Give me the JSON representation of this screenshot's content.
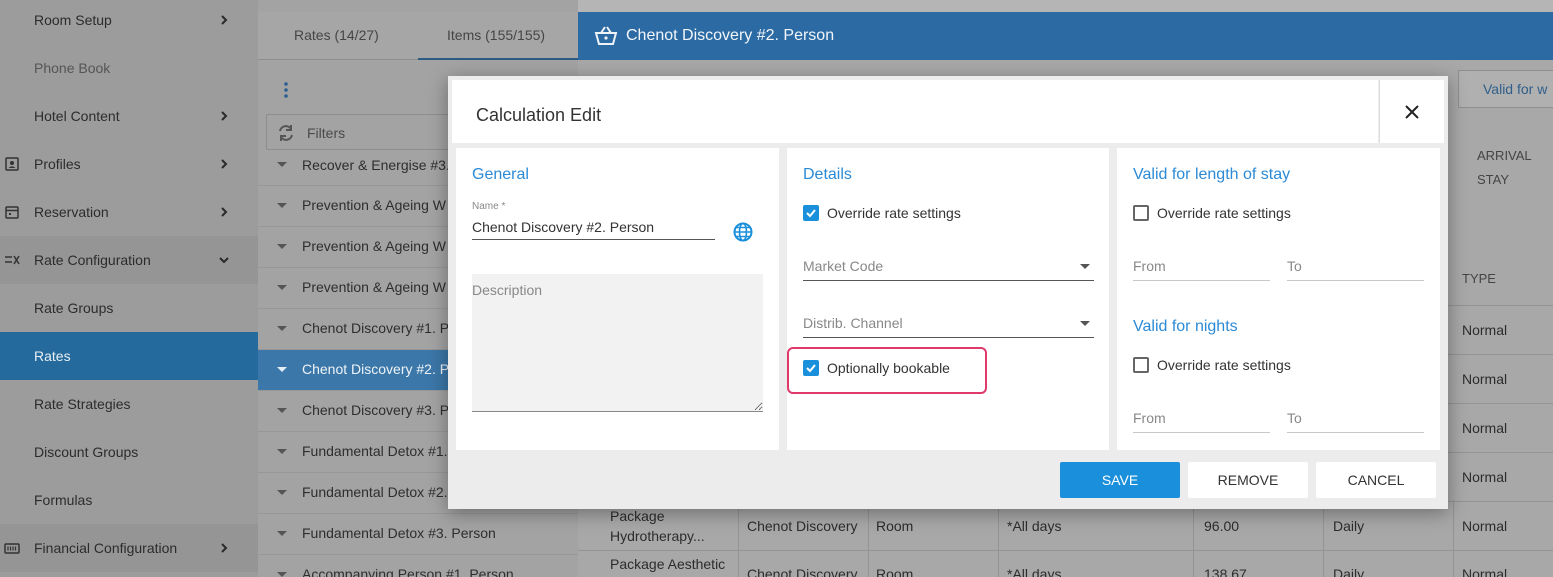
{
  "sidebar": {
    "items": [
      {
        "label": "Room Setup",
        "icon": "none",
        "chevron": "right"
      },
      {
        "label": "Phone Book",
        "icon": "none",
        "chevron": "none"
      },
      {
        "label": "Hotel Content",
        "icon": "none",
        "chevron": "right"
      },
      {
        "label": "Profiles",
        "icon": "profile-icon",
        "chevron": "right"
      },
      {
        "label": "Reservation",
        "icon": "calendar-icon",
        "chevron": "right"
      },
      {
        "label": "Rate Configuration",
        "icon": "rate-config-icon",
        "chevron": "down"
      },
      {
        "label": "Rate Groups",
        "icon": "none",
        "chevron": "none"
      },
      {
        "label": "Rates",
        "icon": "none",
        "chevron": "none",
        "active": true
      },
      {
        "label": "Rate Strategies",
        "icon": "none",
        "chevron": "none"
      },
      {
        "label": "Discount Groups",
        "icon": "none",
        "chevron": "none"
      },
      {
        "label": "Formulas",
        "icon": "none",
        "chevron": "none"
      },
      {
        "label": "Financial Configuration",
        "icon": "financial-icon",
        "chevron": "right"
      }
    ]
  },
  "middle": {
    "tabs": [
      {
        "label": "Rates (14/27)"
      },
      {
        "label": "Items (155/155)",
        "active": true
      }
    ],
    "filters_label": "Filters",
    "rows": [
      {
        "label": "Recover & Energise #3."
      },
      {
        "label": "Prevention & Ageing W"
      },
      {
        "label": "Prevention & Ageing W"
      },
      {
        "label": "Prevention & Ageing W"
      },
      {
        "label": "Chenot Discovery #1. P"
      },
      {
        "label": "Chenot Discovery #2. P",
        "selected": true
      },
      {
        "label": "Chenot Discovery #3. P"
      },
      {
        "label": "Fundamental Detox #1."
      },
      {
        "label": "Fundamental Detox #2."
      },
      {
        "label": "Fundamental Detox #3. Person"
      },
      {
        "label": "Accompanying Person #1. Person"
      }
    ]
  },
  "right": {
    "header_title": "Chenot Discovery #2. Person",
    "tab_partial": "Valid for w",
    "col_arrival": "ARRIVAL",
    "col_stay": "STAY",
    "col_type": "TYPE",
    "type_values": [
      "Normal",
      "Normal",
      "Normal",
      "Normal",
      "Normal",
      "Normal"
    ],
    "rows": [
      {
        "name": "Package Hydrotherapy...",
        "group": "Chenot Discovery",
        "room": "Room",
        "days": "*All days",
        "price": "96.00",
        "freq": "Daily",
        "type": "Normal"
      },
      {
        "name": "Package Aesthetic",
        "group": "Chenot Discovery",
        "room": "Room",
        "days": "*All days",
        "price": "138.67",
        "freq": "Daily",
        "type": "Normal"
      }
    ]
  },
  "modal": {
    "title": "Calculation Edit",
    "general": {
      "title": "General",
      "name_label": "Name *",
      "name_value": "Chenot Discovery #2. Person",
      "description_placeholder": "Description"
    },
    "details": {
      "title": "Details",
      "override_label": "Override rate settings",
      "override_checked": true,
      "market_code_placeholder": "Market Code",
      "distrib_channel_placeholder": "Distrib. Channel",
      "optionally_bookable_label": "Optionally bookable",
      "optionally_bookable_checked": true
    },
    "length_of_stay": {
      "title": "Valid for length of stay",
      "override_label": "Override rate settings",
      "override_checked": false,
      "from_placeholder": "From",
      "to_placeholder": "To"
    },
    "nights": {
      "title": "Valid for nights",
      "override_label": "Override rate settings",
      "override_checked": false,
      "from_placeholder": "From",
      "to_placeholder": "To"
    },
    "buttons": {
      "save": "SAVE",
      "remove": "REMOVE",
      "cancel": "CANCEL"
    }
  },
  "colors": {
    "accent": "#1a8fdb",
    "header_blue": "#2b6aa3",
    "highlight": "#e03a6c"
  }
}
